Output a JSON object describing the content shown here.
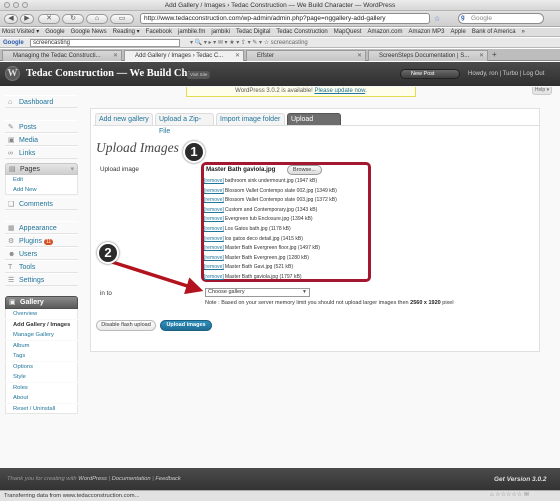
{
  "browser": {
    "window_title": "Add Gallery / Images › Tedac Construction — We Build Character — WordPress",
    "url": "http://www.tedacconstruction.com/wp-admin/admin.php?page=nggallery-add-gallery",
    "search_placeholder": "Google",
    "bookmarks": [
      "Most Visited ▾",
      "Google",
      "Google News",
      "Reading ▾",
      "Facebook",
      "jambile.fm",
      "jambiki",
      "Tedac Digital",
      "Tedac Construction",
      "MapQuest",
      "Amazon.com",
      "Amazon MP3",
      "Apple",
      "Bank of America",
      "»"
    ],
    "google_toolbar": {
      "logo": "Google",
      "query": "screencasting",
      "icons_text": "▾ 🔍 ▾ ▸ ▾ ✉ ▾ ★ ▾ ⇪ ▾ ✎ ▾ ☆ screencasting"
    },
    "tabs": [
      {
        "title": "Managing the Tedac Constructi...",
        "active": false
      },
      {
        "title": "Add Gallery / Images › Tedac C...",
        "active": true
      },
      {
        "title": "Elfster",
        "active": false
      },
      {
        "title": "ScreenSteps Documentation | S...",
        "active": false
      }
    ],
    "status_text": "Transferring data from www.tedacconstruction.com..."
  },
  "header": {
    "site_title": "Tedac Construction — We Build Char...",
    "visit_site": "Visit Site",
    "new_post": "New Post",
    "howdy": "Howdy, ron | Turbo | Log Out",
    "help": "Help ▾"
  },
  "update_nag": {
    "text": "WordPress 3.0.2 is available! ",
    "link": "Please update now",
    "end": "."
  },
  "sidebar": {
    "dashboard": "Dashboard",
    "posts": "Posts",
    "media": "Media",
    "links": "Links",
    "pages": "Pages",
    "pages_sub": [
      "Edit",
      "Add New"
    ],
    "comments": "Comments",
    "appearance": "Appearance",
    "plugins": "Plugins",
    "plugins_badge": "11",
    "users": "Users",
    "tools": "Tools",
    "settings": "Settings",
    "gallery": "Gallery",
    "gallery_sub": [
      "Overview",
      "Add Gallery / Images",
      "Manage Gallery",
      "Album",
      "Tags",
      "Options",
      "Style",
      "Roles",
      "About",
      "Reset / Uninstall"
    ]
  },
  "gallery_tabs": [
    "Add new gallery",
    "Upload a Zip-File",
    "Import image folder",
    "Upload Images"
  ],
  "upload": {
    "title": "Upload Images",
    "label_upload": "Upload image",
    "label_into": "in to",
    "current_file": "Master Bath gaviola.jpg",
    "browse": "Browse...",
    "remove_label": "[remove]",
    "files": [
      "bathroom sink undermount.jpg (1947 kB)",
      "Blossom Vallet Contempo slate 002.jpg (1349 kB)",
      "Blossom Vallet Contempo slate 003.jpg (1372 kB)",
      "Custom and Contemporary.jpg (1343 kB)",
      "Evergreen tub Enclosure.jpg (1394 kB)",
      "Los Gatos bath.jpg (1178 kB)",
      "los gatos deco detail.jpg (1415 kB)",
      "Master Bath Evergreen floor.jpg (1497 kB)",
      "Master Bath Evergreen.jpg (1280 kB)",
      "Master Bath Gavi.jpg (521 kB)",
      "Master Bath gaviola.jpg (1797 kB)"
    ],
    "gallery_select": "Choose gallery",
    "note_prefix": "Note : Based on your server memory limit you should not upload larger images then ",
    "note_size": "2560 x 1920",
    "note_suffix": " pixel",
    "disable_flash": "Disable flash upload",
    "upload_button": "Upload images"
  },
  "callouts": [
    "1",
    "2"
  ],
  "footer": {
    "thanks_prefix": "Thank you for creating with ",
    "wordpress": "WordPress",
    "documentation": "Documentation",
    "feedback": "Feedback",
    "version": "Get Version 3.0.2"
  },
  "colors": {
    "accent_red": "#a3182e",
    "link_blue": "#21759b",
    "primary_button": "#2e8fbd"
  }
}
